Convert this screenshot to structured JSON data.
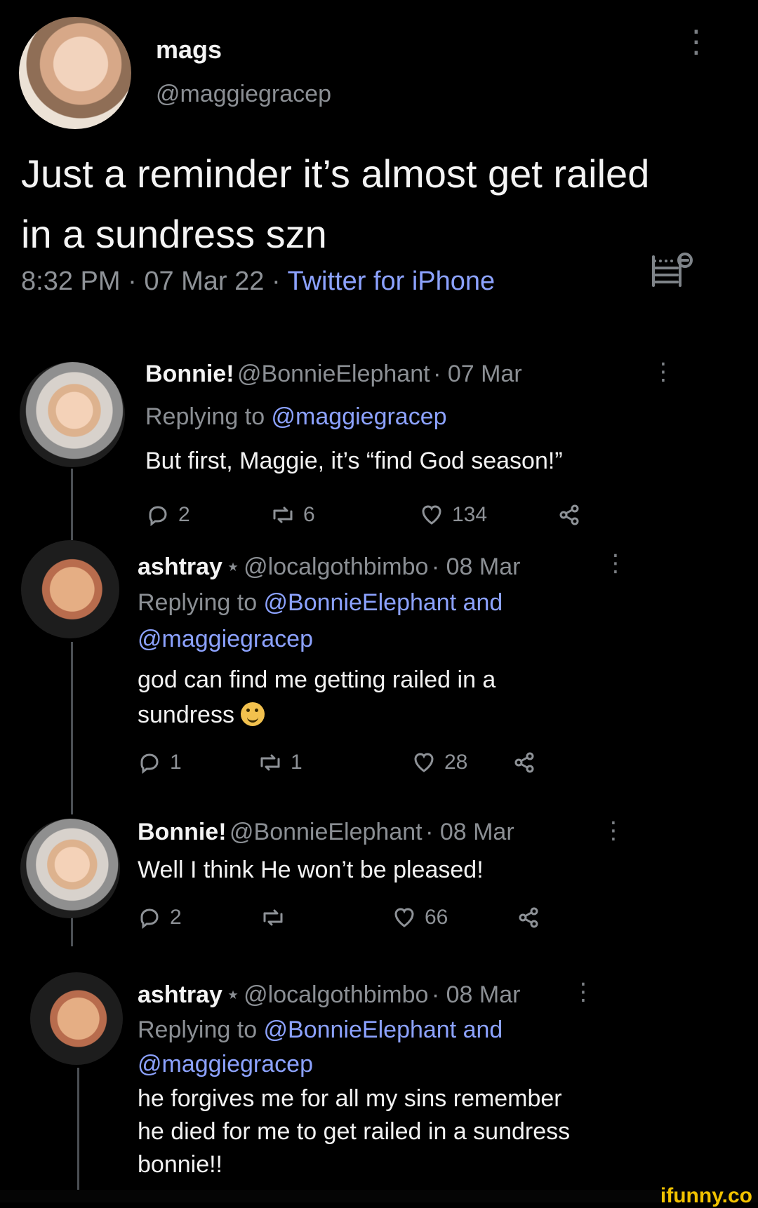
{
  "main_tweet": {
    "display_name": "mags",
    "handle": "@maggiegracep",
    "text": "Just a reminder it’s almost get railed in a sundress szn",
    "time": "8:32 PM",
    "date": "07 Mar 22",
    "source": "Twitter for iPhone",
    "separator": " · "
  },
  "replies": [
    {
      "display_name": "Bonnie!",
      "handle": "@BonnieElephant",
      "date": "07 Mar",
      "replying_prefix": "Replying to ",
      "replying_to_1": "@maggiegracep",
      "text": "But first, Maggie, it’s “find God season!”",
      "reply_count": "2",
      "retweet_count": "6",
      "like_count": "134"
    },
    {
      "display_name": "ashtray",
      "handle": "@localgothbimbo",
      "date": "08 Mar",
      "replying_prefix": "Replying to ",
      "replying_to_1": "@BonnieElephant and",
      "replying_to_2": "@maggiegracep",
      "text_line_1": "god can find me getting railed in a",
      "text_line_2": "sundress",
      "reply_count": "1",
      "retweet_count": "1",
      "like_count": "28"
    },
    {
      "display_name": "Bonnie!",
      "handle": "@BonnieElephant",
      "date": "08 Mar",
      "text": "Well I think He won’t be pleased!",
      "reply_count": "2",
      "retweet_count": "",
      "like_count": "66"
    },
    {
      "display_name": "ashtray",
      "handle": "@localgothbimbo",
      "date": "08 Mar",
      "replying_prefix": "Replying to ",
      "replying_to_1": "@BonnieElephant and",
      "replying_to_2": "@maggiegracep",
      "text_line_1": "he forgives me for all my sins remember",
      "text_line_2": "he died for me to get railed in a sundress",
      "text_line_3": "bonnie!!"
    }
  ],
  "watermark": "ifunny.co",
  "icons": {
    "menu": "more-vertical-icon",
    "analytics": "analytics-icon",
    "reply": "reply-icon",
    "retweet": "retweet-icon",
    "like": "like-icon",
    "share": "share-icon",
    "emoji": "grinning-face-with-tongue-icon"
  },
  "colors": {
    "background": "#000000",
    "text": "#f3f3f3",
    "muted": "#8b8f94",
    "mention": "#8ca2ff",
    "watermark": "#f2c200"
  }
}
